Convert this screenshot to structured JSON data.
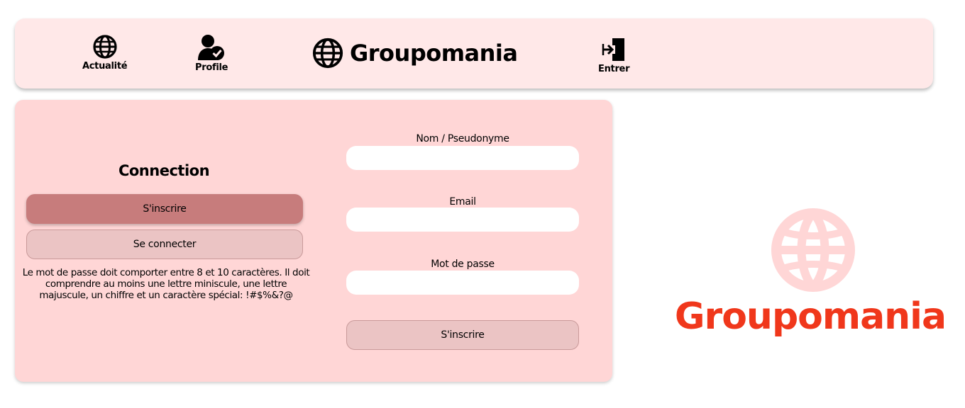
{
  "nav": {
    "actualite": {
      "label": "Actualité",
      "icon": "globe-icon"
    },
    "profile": {
      "label": "Profile",
      "icon": "user-check-icon"
    },
    "brand": {
      "label": "Groupomania",
      "icon": "globe-icon"
    },
    "entrer": {
      "label": "Entrer",
      "icon": "sign-in-icon"
    }
  },
  "auth": {
    "title": "Connection",
    "signup_tab": "S'inscrire",
    "login_tab": "Se connecter",
    "password_note": "Le mot de passe doit comporter entre 8 et 10 caractères. Il doit comprendre au moins une lettre miniscule, une lettre majuscule, un chiffre et un caractère spécial: !#$%&?@"
  },
  "form": {
    "name_label": "Nom / Pseudonyme",
    "name_value": "",
    "email_label": "Email",
    "email_value": "",
    "password_label": "Mot de passe",
    "password_value": "",
    "submit_label": "S'inscrire"
  },
  "logo": {
    "text": "Groupomania",
    "color": "#f0371b",
    "globe_color": "#ffd6d6"
  },
  "colors": {
    "navbar_bg": "#ffe8e8",
    "panel_bg": "#ffd6d6",
    "active_tab": "#c77c7c",
    "inactive_tab": "#ebc4c4"
  }
}
